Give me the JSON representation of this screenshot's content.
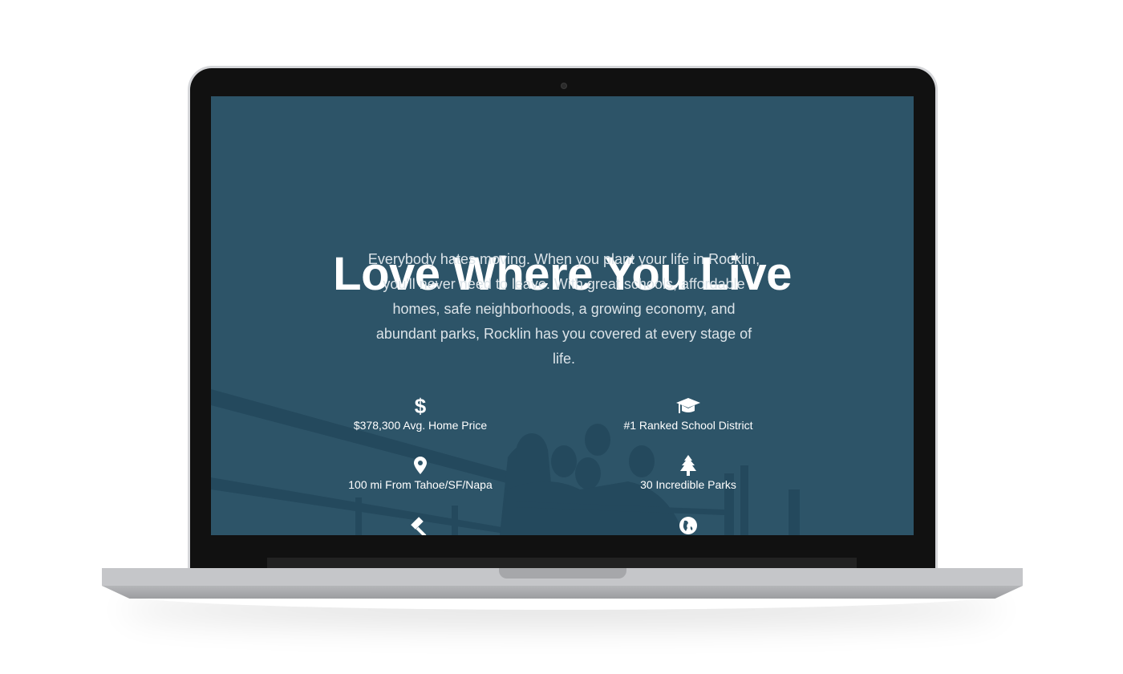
{
  "hero": {
    "title": "Love Where You Live",
    "paragraph": "Everybody hates moving. When you plant your life in Rocklin, you'll never need to leave. With great schools, affordable homes, safe neighborhoods, a growing economy, and abundant parks, Rocklin has you covered at every stage of life."
  },
  "features": [
    {
      "icon": "dollar-icon",
      "label": "$378,300 Avg. Home Price"
    },
    {
      "icon": "graduation-cap-icon",
      "label": "#1 Ranked School District"
    },
    {
      "icon": "map-pin-icon",
      "label": "100 mi From Tahoe/SF/Napa"
    },
    {
      "icon": "tree-icon",
      "label": "30 Incredible Parks"
    },
    {
      "icon": "gavel-icon",
      "label": ""
    },
    {
      "icon": "globe-icon",
      "label": ""
    }
  ],
  "colors": {
    "screen_bg": "#2d5468",
    "text": "#ffffff"
  }
}
